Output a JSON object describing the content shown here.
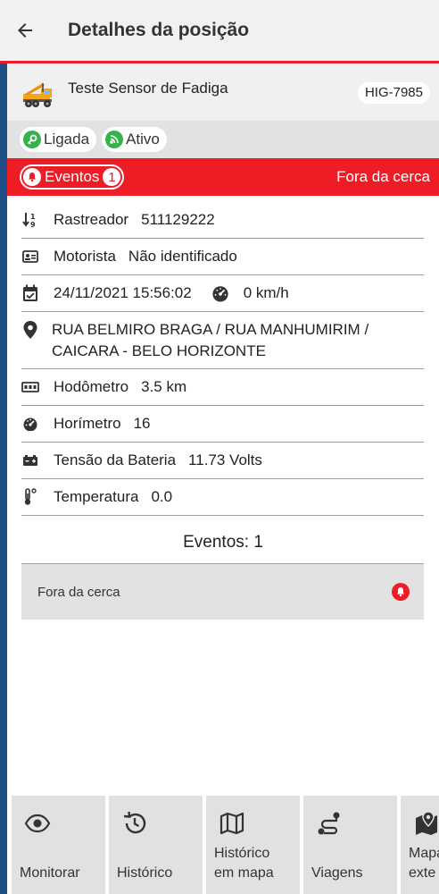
{
  "header": {
    "title": "Detalhes da posição",
    "back_icon": "arrow-left-icon"
  },
  "vehicle": {
    "name": "Teste Sensor de Fadiga",
    "plate": "HIG-7985",
    "icon": "crane-truck-icon"
  },
  "status": {
    "ignition_label": "Ligada",
    "ignition_icon": "key-icon",
    "signal_label": "Ativo",
    "signal_icon": "signal-icon",
    "chip_color": "#35b34a"
  },
  "events_bar": {
    "label": "Eventos",
    "count": "1",
    "fence_status": "Fora da cerca",
    "color": "#ee1c25"
  },
  "details": {
    "tracker_label": "Rastreador",
    "tracker_value": "511129222",
    "driver_label": "Motorista",
    "driver_value": "Não identificado",
    "datetime": "24/11/2021 15:56:02",
    "speed": "0 km/h",
    "address_line1": "RUA BELMIRO BRAGA / RUA MANHUMIRIM /",
    "address_line2": "CAICARA - BELO HORIZONTE",
    "odometer_label": "Hodômetro",
    "odometer_value": "3.5 km",
    "hourmeter_label": "Horímetro",
    "hourmeter_value": "16",
    "battery_label": "Tensão da Bateria",
    "battery_value": "11.73 Volts",
    "temperature_label": "Temperatura",
    "temperature_value": "0.0"
  },
  "events_section": {
    "title": "Eventos: 1",
    "items": [
      {
        "label": "Fora da cerca",
        "icon": "bell-icon"
      }
    ]
  },
  "bottom_nav": {
    "items": [
      {
        "label": "Monitorar",
        "icon": "eye-icon"
      },
      {
        "label": "Histórico",
        "icon": "history-icon"
      },
      {
        "label_line1": "Histórico",
        "label_line2": "em mapa",
        "icon": "map-icon"
      },
      {
        "label": "Viagens",
        "icon": "route-icon"
      },
      {
        "label_line1": "Mapa",
        "label_line2": "exte",
        "icon": "map-pin-icon"
      }
    ]
  },
  "colors": {
    "accent_red": "#ee1c25",
    "sidebar_blue": "#1d4f86",
    "header_bg": "#f1f1f1"
  }
}
